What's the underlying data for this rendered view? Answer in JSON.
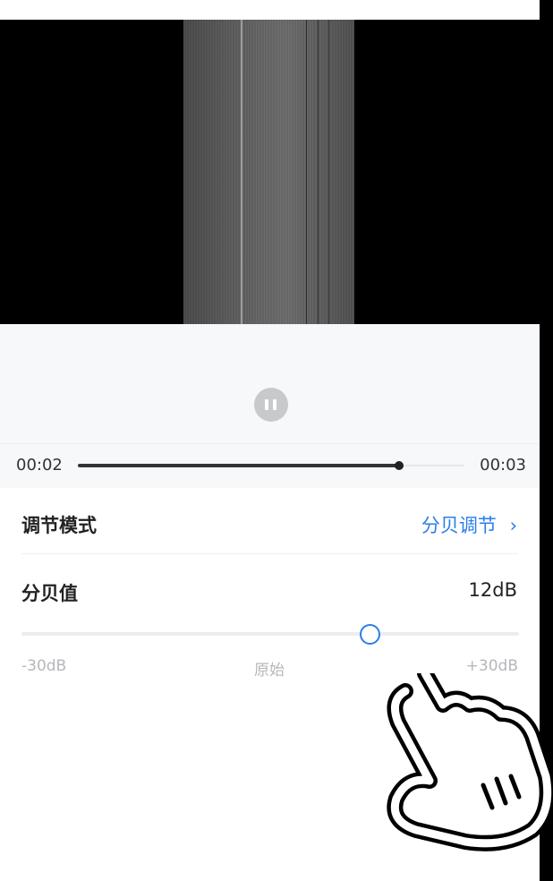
{
  "player": {
    "time_current": "00:02",
    "time_total": "00:03",
    "progress": 0.83,
    "state_icon": "pause-icon"
  },
  "settings": {
    "mode_label": "调节模式",
    "mode_value": "分贝调节",
    "mode_chevron": "›",
    "db_label": "分贝值",
    "db_value": "12dB",
    "slider": {
      "min": -30,
      "max": 30,
      "value": 12
    },
    "scale_min": "-30dB",
    "scale_mid": "原始",
    "scale_max": "+30dB"
  },
  "colors": {
    "accent": "#2b7ee8",
    "background": "#ffffff",
    "controls_bg": "#f7f8fa"
  },
  "overlay": {
    "icon": "tap-hand-icon"
  }
}
